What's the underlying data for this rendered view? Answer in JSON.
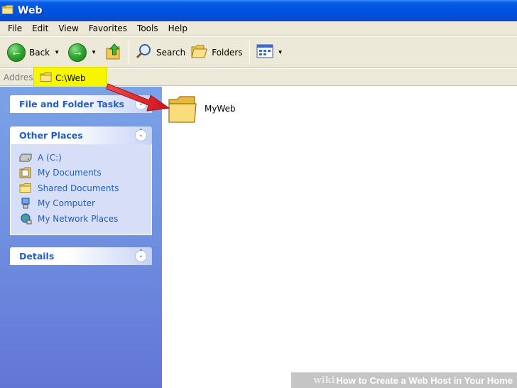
{
  "window": {
    "title": "Web"
  },
  "menu": [
    "File",
    "Edit",
    "View",
    "Favorites",
    "Tools",
    "Help"
  ],
  "toolbar": {
    "back": "Back",
    "search": "Search",
    "folders": "Folders"
  },
  "address": {
    "label": "Address",
    "value": "C:\\Web"
  },
  "tasks": {
    "file_folder": "File and Folder Tasks",
    "other_places": "Other Places",
    "places": [
      "A (C:)",
      "My Documents",
      "Shared Documents",
      "My Computer",
      "My Network Places"
    ],
    "details": "Details"
  },
  "content": {
    "folder_name": "MyWeb"
  },
  "watermark": {
    "brand": "wiki",
    "text": "How to Create a Web Host in Your Home"
  },
  "colors": {
    "titlebar": "#0054e3",
    "highlight": "#f6f600",
    "arrow": "#e8202a",
    "link": "#215dc6"
  }
}
